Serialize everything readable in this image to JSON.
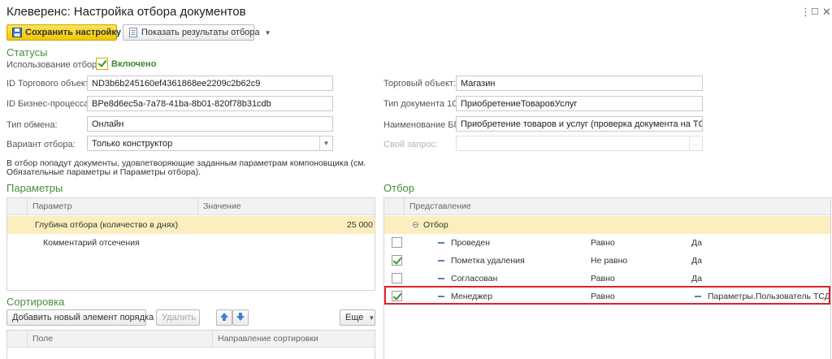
{
  "window": {
    "title": "Клеверенс: Настройка отбора документов",
    "controls": [
      "⋮",
      "☐",
      "✕"
    ]
  },
  "toolbar": {
    "save_label": "Сохранить настройку",
    "show_results_label": "Показать результаты отбора"
  },
  "statuses": {
    "section_title": "Статусы",
    "use_filter_label": "Использование отбора:",
    "use_filter_value": "Включено",
    "use_filter_checked": true
  },
  "left_fields": [
    {
      "label": "ID Торгового объекта:",
      "value": "ND3b6b245160ef4361868ee2209c2b62c9"
    },
    {
      "label": "ID Бизнес-процесса:",
      "value": "BPe8d6ec5a-7a78-41ba-8b01-820f78b31cdb"
    },
    {
      "label": "Тип обмена:",
      "value": "Онлайн"
    },
    {
      "label": "Вариант отбора:",
      "value": "Только конструктор"
    }
  ],
  "right_fields": [
    {
      "label": "Торговый объект:",
      "value": "Магазин"
    },
    {
      "label": "Тип документа 1С:",
      "value": "ПриобретениеТоваровУслуг"
    },
    {
      "label": "Наименование БП:",
      "value": "Приобретение товаров и услуг (проверка документа на ТСД)"
    },
    {
      "label": "Свой запрос:",
      "value": ""
    }
  ],
  "info_text_1": "В отбор попадут документы, удовлетворяющие заданным параметрам компоновщика (см.",
  "info_text_2": "Обязательные параметры и Параметры отбора).",
  "parameters": {
    "section_title": "Параметры",
    "columns": [
      "Параметр",
      "Значение"
    ],
    "rows": [
      {
        "name": "Глубина отбора (количество в днях)",
        "value": "25 000"
      },
      {
        "name": "Комментарий отсечения",
        "value": ""
      }
    ]
  },
  "sorting": {
    "section_title": "Сортировка",
    "add_label": "Добавить новый элемент порядка",
    "delete_label": "Удалить",
    "more_label": "Еще",
    "columns": [
      "Поле",
      "Направление сортировки"
    ]
  },
  "filter": {
    "section_title": "Отбор",
    "column": "Представление",
    "group_label": "Отбор",
    "rows": [
      {
        "checked": false,
        "field": "Проведен",
        "comparison": "Равно",
        "value": "Да",
        "value_is_param": false
      },
      {
        "checked": true,
        "field": "Пометка удаления",
        "comparison": "Не равно",
        "value": "Да",
        "value_is_param": false
      },
      {
        "checked": false,
        "field": "Согласован",
        "comparison": "Равно",
        "value": "Да",
        "value_is_param": false
      },
      {
        "checked": true,
        "field": "Менеджер",
        "comparison": "Равно",
        "value": "Параметры.Пользователь ТСД",
        "value_is_param": true
      }
    ]
  },
  "colors": {
    "accent_green": "#4a8c3f",
    "primary_button": "#f2c600",
    "selected_row": "#fbefc0",
    "highlight_red": "#d9232d"
  }
}
